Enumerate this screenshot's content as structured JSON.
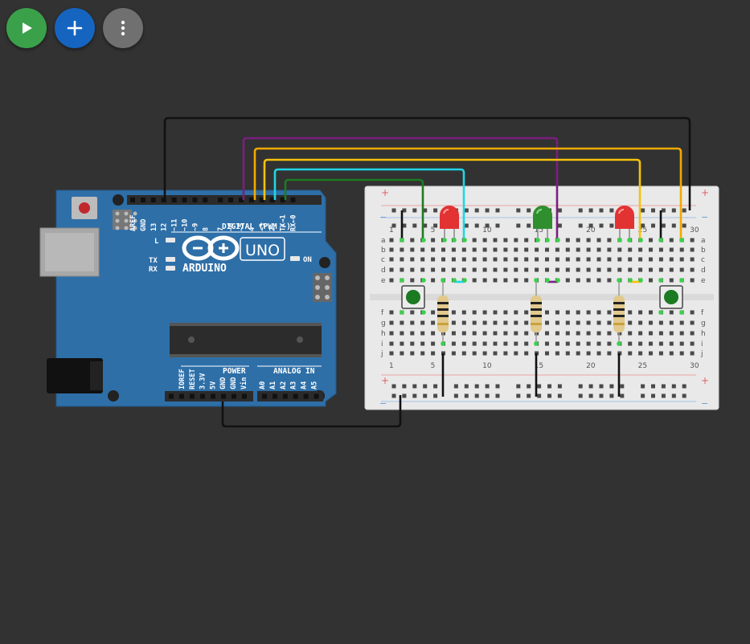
{
  "toolbar": {
    "run_icon": "play-icon",
    "add_icon": "plus-icon",
    "more_icon": "more-vertical-icon",
    "colors": {
      "run": "#3aa14a",
      "add": "#1565c0",
      "more": "#707070"
    }
  },
  "arduino": {
    "brand": "ARDUINO",
    "model": "UNO",
    "digital_header": "DIGITAL (PWM ~)",
    "power_header": "POWER",
    "analog_header": "ANALOG IN",
    "label_L": "L",
    "label_TX": "TX",
    "label_RX": "RX",
    "label_ON": "ON",
    "digital_pins": [
      "AREF",
      "GND",
      "13",
      "12",
      "~11",
      "~10",
      "~9",
      "8",
      "7",
      "~6",
      "~5",
      "4",
      "~3",
      "2",
      "TX→1",
      "RX←0"
    ],
    "power_pins": [
      "IOREF",
      "RESET",
      "3.3V",
      "5V",
      "GND",
      "GND",
      "Vin"
    ],
    "analog_pins": [
      "A0",
      "A1",
      "A2",
      "A3",
      "A4",
      "A5"
    ],
    "board_color": "#2e6fa8"
  },
  "breadboard": {
    "column_numbers": [
      "1",
      "5",
      "10",
      "15",
      "20",
      "25",
      "30"
    ],
    "rows_top": [
      "a",
      "b",
      "c",
      "d",
      "e"
    ],
    "rows_bottom": [
      "f",
      "g",
      "h",
      "i",
      "j"
    ],
    "rail_plus": "+",
    "rail_minus": "−"
  },
  "components": {
    "leds": [
      "red",
      "green",
      "red"
    ],
    "buttons": 2,
    "resistors": 3
  },
  "wire_colors": {
    "gnd": "#111111",
    "purple": "#7a1f7f",
    "orange": "#f2a900",
    "cyan": "#1fd6e6",
    "green": "#1e7a22",
    "yellow": "#f4c20d"
  }
}
